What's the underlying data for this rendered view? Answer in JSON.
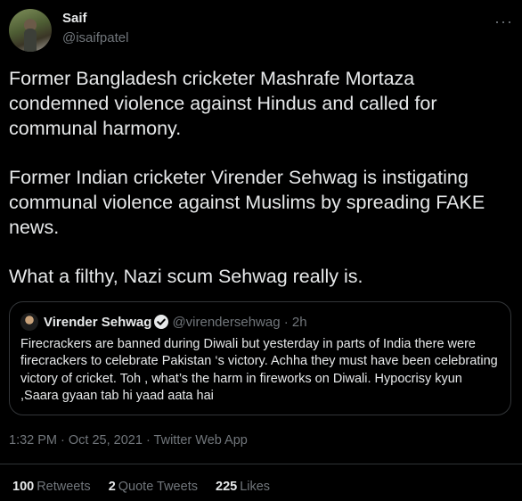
{
  "author": {
    "display_name": "Saif",
    "handle": "@isaifpatel",
    "more_glyph": "···"
  },
  "tweet": {
    "paragraphs": [
      "Former Bangladesh cricketer Mashrafe Mortaza condemned violence against Hindus and called for communal harmony.",
      "Former Indian cricketer Virender Sehwag is instigating communal violence against Muslims by spreading FAKE news.",
      "What a filthy, Nazi scum Sehwag really is."
    ]
  },
  "quoted_tweet": {
    "display_name": "Virender Sehwag",
    "verified": true,
    "handle_time": "@virendersehwag · 2h",
    "text": "Firecrackers are banned during Diwali but yesterday in parts of India there were firecrackers to celebrate Pakistan ‘s victory. Achha they must have been celebrating victory of cricket. Toh , what’s the harm in fireworks on Diwali. Hypocrisy kyun ,Saara gyaan tab hi yaad aata hai"
  },
  "meta": "1:32 PM · Oct 25, 2021 · Twitter Web App",
  "stats": {
    "retweets_count": "100",
    "retweets_label": "Retweets",
    "quotes_count": "2",
    "quotes_label": "Quote Tweets",
    "likes_count": "225",
    "likes_label": "Likes"
  },
  "colors": {
    "background": "#000000",
    "text": "#e7e9ea",
    "secondary": "#71767b",
    "border": "#333639",
    "verified_badge": "#e7e9ea"
  },
  "icons": [
    "avatar",
    "more-icon",
    "verified-badge-icon"
  ]
}
